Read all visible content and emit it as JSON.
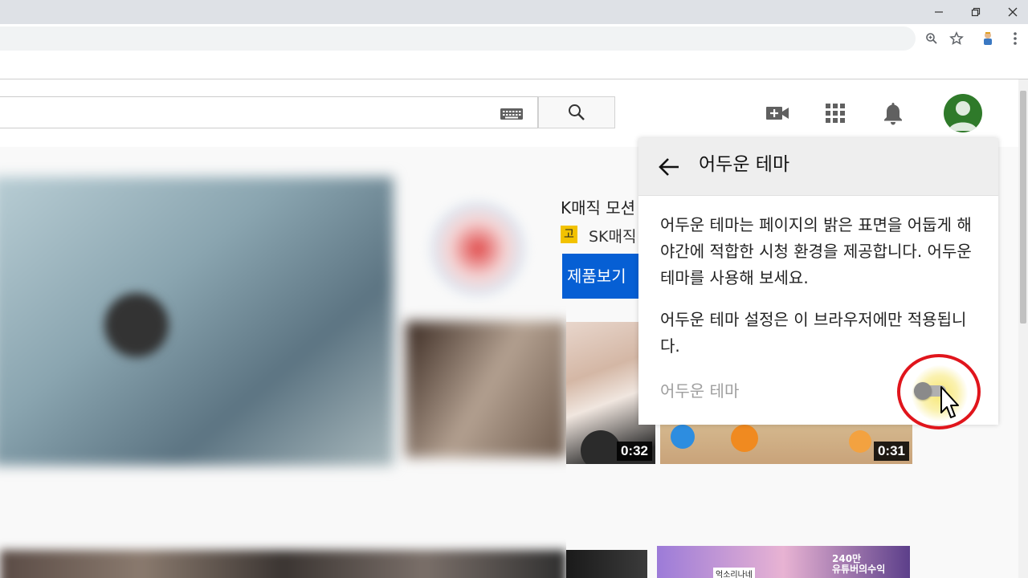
{
  "browser": {
    "window_controls": [
      "minimize",
      "maximize",
      "close"
    ],
    "toolbar_icons": [
      "zoom-icon",
      "star-icon",
      "extension-icon",
      "menu-icon"
    ]
  },
  "youtube": {
    "header_icons": [
      "create-video-icon",
      "apps-grid-icon",
      "notifications-bell-icon"
    ]
  },
  "promo": {
    "title": "K매직 모션",
    "badge": "고",
    "brand": "SK매직",
    "button": "제품보기"
  },
  "videos": [
    {
      "duration": "0:32"
    },
    {
      "duration": "0:31"
    }
  ],
  "thumb4_texts": [
    "억소리나네",
    "240만\n유튜버의수익"
  ],
  "popup": {
    "title": "어두운 테마",
    "description": "어두운 테마는 페이지의 밝은 표면을 어둡게 해 야간에 적합한 시청 환경을 제공합니다. 어두운 테마를 사용해 보세요.",
    "note": "어두운 테마 설정은 이 브라우저에만 적용됩니다.",
    "toggle_label": "어두운 테마",
    "toggle_on": false
  },
  "colors": {
    "accent_blue": "#065fd4",
    "highlight_ring": "#e0151c",
    "avatar_green": "#2f7a2a"
  }
}
